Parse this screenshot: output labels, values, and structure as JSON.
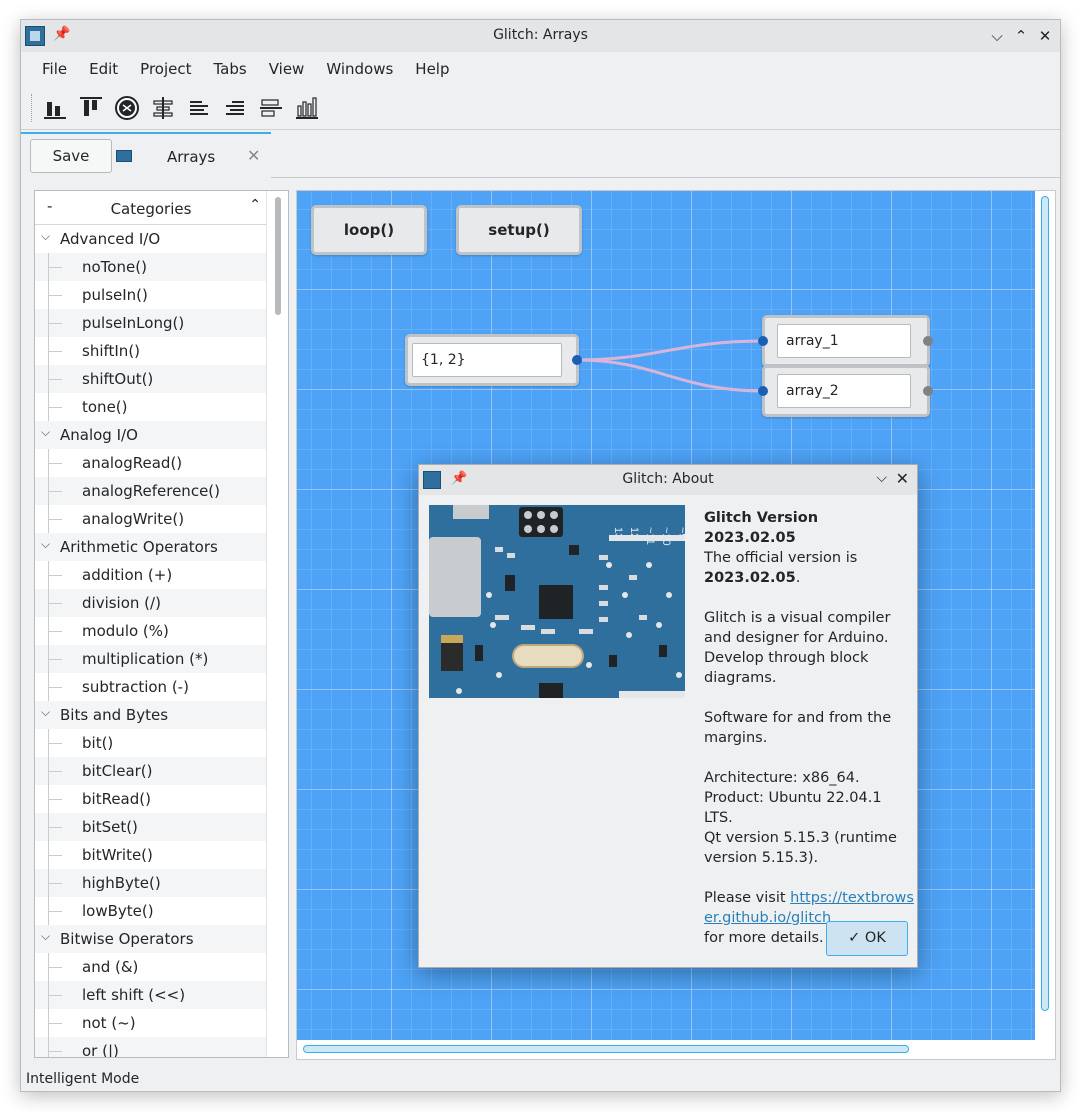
{
  "window": {
    "title": "Glitch: Arrays",
    "min_glyph": "⌵",
    "max_glyph": "⌃",
    "close_glyph": "✕"
  },
  "menu": [
    "File",
    "Edit",
    "Project",
    "Tabs",
    "View",
    "Windows",
    "Help"
  ],
  "toolbar": {
    "icons": [
      "align-bottom-icon",
      "align-top-icon",
      "compress-icon",
      "align-vertical-center-icon",
      "align-left-icon",
      "align-right-icon",
      "align-horizontal-center-icon",
      "distribute-icon"
    ]
  },
  "tabs": {
    "save_label": "Save",
    "active_tab": "Arrays",
    "close_glyph": "✕"
  },
  "tree": {
    "header": "Categories",
    "header_dash": "-",
    "header_caret": "⌃",
    "rows": [
      {
        "label": "Advanced I/O",
        "type": "cat"
      },
      {
        "label": "noTone()",
        "type": "leaf"
      },
      {
        "label": "pulseIn()",
        "type": "leaf"
      },
      {
        "label": "pulseInLong()",
        "type": "leaf"
      },
      {
        "label": "shiftIn()",
        "type": "leaf"
      },
      {
        "label": "shiftOut()",
        "type": "leaf"
      },
      {
        "label": "tone()",
        "type": "leaf"
      },
      {
        "label": "Analog I/O",
        "type": "cat"
      },
      {
        "label": "analogRead()",
        "type": "leaf"
      },
      {
        "label": "analogReference()",
        "type": "leaf"
      },
      {
        "label": "analogWrite()",
        "type": "leaf"
      },
      {
        "label": "Arithmetic Operators",
        "type": "cat"
      },
      {
        "label": "addition (+)",
        "type": "leaf"
      },
      {
        "label": "division (/)",
        "type": "leaf"
      },
      {
        "label": "modulo (%)",
        "type": "leaf"
      },
      {
        "label": "multiplication (*)",
        "type": "leaf"
      },
      {
        "label": "subtraction (-)",
        "type": "leaf"
      },
      {
        "label": "Bits and Bytes",
        "type": "cat"
      },
      {
        "label": "bit()",
        "type": "leaf"
      },
      {
        "label": "bitClear()",
        "type": "leaf"
      },
      {
        "label": "bitRead()",
        "type": "leaf"
      },
      {
        "label": "bitSet()",
        "type": "leaf"
      },
      {
        "label": "bitWrite()",
        "type": "leaf"
      },
      {
        "label": "highByte()",
        "type": "leaf"
      },
      {
        "label": "lowByte()",
        "type": "leaf"
      },
      {
        "label": "Bitwise Operators",
        "type": "cat"
      },
      {
        "label": "and (&)",
        "type": "leaf"
      },
      {
        "label": "left shift (<<)",
        "type": "leaf"
      },
      {
        "label": "not (~)",
        "type": "leaf"
      },
      {
        "label": "or (|)",
        "type": "leaf"
      }
    ]
  },
  "canvas": {
    "loop_label": "loop()",
    "setup_label": "setup()",
    "source_value": "{1, 2}",
    "array1_value": "array_1",
    "array2_value": "array_2"
  },
  "status": "Intelligent Mode",
  "about": {
    "title": "Glitch: About",
    "pin_glyph": "📌",
    "chev_glyph": "⌵",
    "close_glyph": "✕",
    "version_heading": "Glitch Version 2023.02.05",
    "official_line": "The official version is",
    "official_version": "2023.02.05",
    "official_period": ".",
    "desc1": "Glitch is a visual compiler and designer for Arduino. Develop through block diagrams.",
    "desc2": "Software for and from the margins.",
    "arch": "Architecture: x86_64.",
    "product": "Product: Ubuntu 22.04.1 LTS.",
    "qt": "Qt version 5.15.3 (runtime version 5.15.3).",
    "visit_prefix": "Please visit ",
    "link": "https://textbrowser.github.io/glitch",
    "visit_suffix": "for more details.",
    "ok_label": "✓  OK",
    "board_pins": [
      "13",
      "12",
      "~11",
      "~10",
      "~9"
    ]
  },
  "colors": {
    "accent": "#3daee9",
    "canvas_bg": "#4ea3f7",
    "wire": "#d8b4d8",
    "port": "#1a5fb4"
  }
}
